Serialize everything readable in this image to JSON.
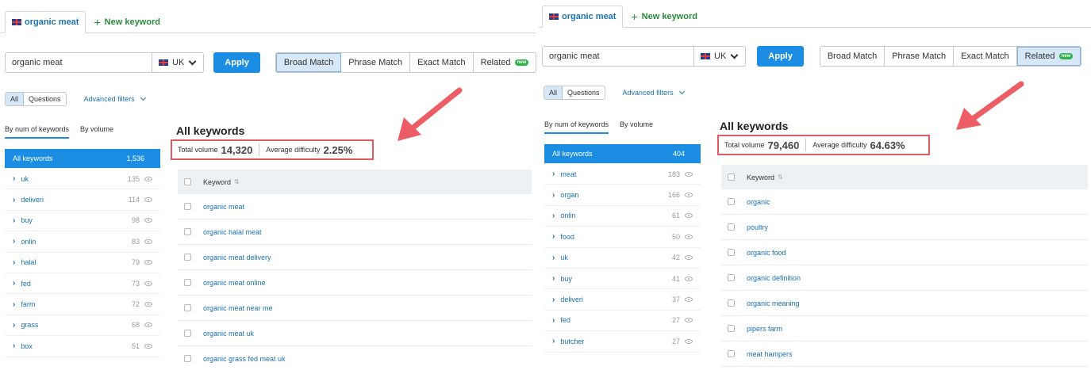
{
  "left": {
    "tab_active": "organic meat",
    "tab_new": "New keyword",
    "search_value": "organic meat",
    "database": "UK",
    "apply": "Apply",
    "match_modes": [
      {
        "label": "Broad Match",
        "active": true
      },
      {
        "label": "Phrase Match",
        "active": false
      },
      {
        "label": "Exact Match",
        "active": false
      },
      {
        "label": "Related",
        "active": false,
        "badge": "new"
      }
    ],
    "filter_all": "All",
    "filter_questions": "Questions",
    "advanced_filters": "Advanced filters",
    "side_tab_keywords": "By num of keywords",
    "side_tab_volume": "By volume",
    "groups": [
      {
        "name": "All keywords",
        "count": "1,536"
      },
      {
        "name": "uk",
        "count": "135"
      },
      {
        "name": "deliveri",
        "count": "114"
      },
      {
        "name": "buy",
        "count": "98"
      },
      {
        "name": "onlin",
        "count": "83"
      },
      {
        "name": "halal",
        "count": "79"
      },
      {
        "name": "fed",
        "count": "73"
      },
      {
        "name": "farm",
        "count": "72"
      },
      {
        "name": "grass",
        "count": "68"
      },
      {
        "name": "box",
        "count": "51"
      }
    ],
    "title": "All keywords",
    "total_volume_label": "Total volume",
    "total_volume": "14,320",
    "avg_difficulty_label": "Average difficulty",
    "avg_difficulty": "2.25%",
    "column_keyword": "Keyword",
    "keywords": [
      "organic meat",
      "organic halal meat",
      "organic meat delivery",
      "organic meat online",
      "organic meat near me",
      "organic meat uk",
      "organic grass fed meat uk"
    ]
  },
  "right": {
    "tab_active": "organic meat",
    "tab_new": "New keyword",
    "search_value": "organic meat",
    "database": "UK",
    "apply": "Apply",
    "match_modes": [
      {
        "label": "Broad Match",
        "active": false
      },
      {
        "label": "Phrase Match",
        "active": false
      },
      {
        "label": "Exact Match",
        "active": false
      },
      {
        "label": "Related",
        "active": true,
        "badge": "new"
      }
    ],
    "filter_all": "All",
    "filter_questions": "Questions",
    "advanced_filters": "Advanced filters",
    "side_tab_keywords": "By num of keywords",
    "side_tab_volume": "By volume",
    "groups": [
      {
        "name": "All keywords",
        "count": "404"
      },
      {
        "name": "meat",
        "count": "183"
      },
      {
        "name": "organ",
        "count": "166"
      },
      {
        "name": "onlin",
        "count": "61"
      },
      {
        "name": "food",
        "count": "50"
      },
      {
        "name": "uk",
        "count": "42"
      },
      {
        "name": "buy",
        "count": "41"
      },
      {
        "name": "deliveri",
        "count": "37"
      },
      {
        "name": "fed",
        "count": "27"
      },
      {
        "name": "butcher",
        "count": "27"
      }
    ],
    "title": "All keywords",
    "total_volume_label": "Total volume",
    "total_volume": "79,460",
    "avg_difficulty_label": "Average difficulty",
    "avg_difficulty": "64.63%",
    "column_keyword": "Keyword",
    "keywords": [
      "organic",
      "poultry",
      "organic food",
      "organic definition",
      "organic meaning",
      "pipers farm",
      "meat hampers"
    ]
  },
  "colors": {
    "accent": "#1b8ee3",
    "link": "#1a73b5",
    "highlight": "#e05a5f",
    "new_keyword": "#2a8b3c"
  },
  "icons": [
    "uk-flag-icon",
    "plus-icon",
    "chevron-down-icon",
    "eye-icon",
    "sort-icon",
    "arrow-icon"
  ]
}
